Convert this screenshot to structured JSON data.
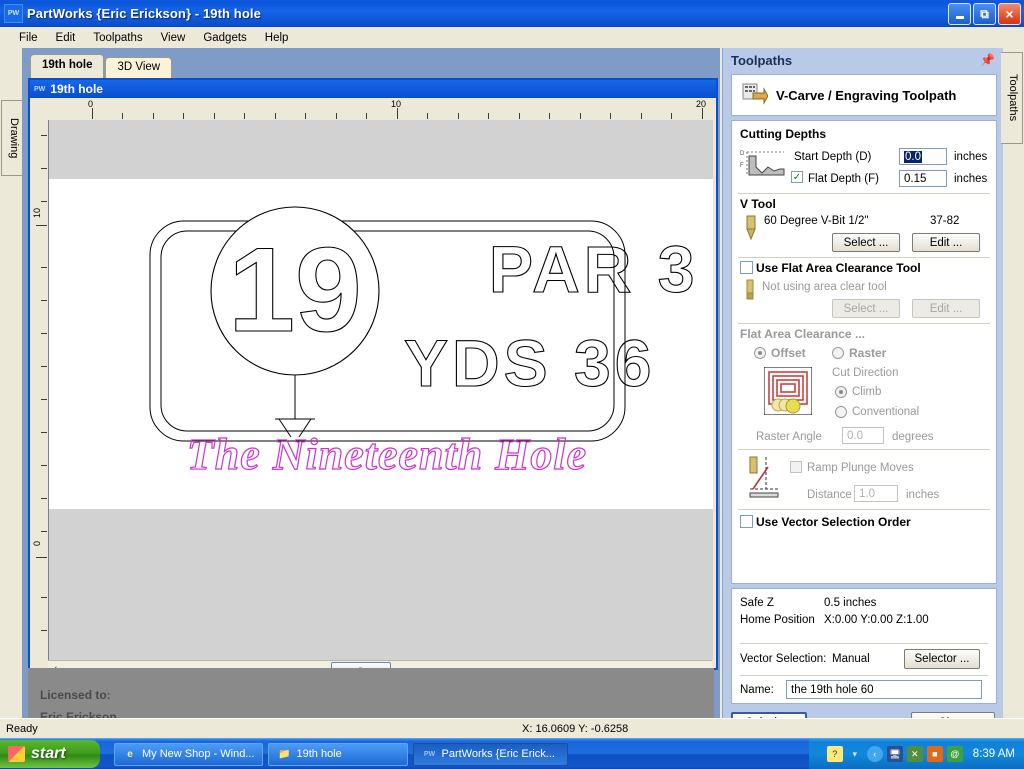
{
  "window": {
    "title": "PartWorks {Eric Erickson} - 19th hole",
    "app_icon": "PW",
    "minimize_label": "_",
    "restore_label": "❐",
    "close_label": "×"
  },
  "menubar": {
    "items": [
      "File",
      "Edit",
      "Toolpaths",
      "View",
      "Gadgets",
      "Help"
    ]
  },
  "left_dock": {
    "tab_label": "Drawing"
  },
  "right_dock": {
    "tab_label": "Toolpaths"
  },
  "document": {
    "tabs": [
      {
        "label": "19th hole",
        "active": true
      },
      {
        "label": "3D View",
        "active": false
      }
    ],
    "child_window_title": "19th hole",
    "child_window_icon": "PW",
    "h_ruler_labels": [
      "0",
      "10",
      "20"
    ],
    "v_ruler_labels": [
      "10",
      "0"
    ],
    "scroll_left_arrow": "‹",
    "scroll_thumb_grip": "‖"
  },
  "artwork": {
    "number_badge": "19",
    "line1": "PAR 3",
    "line2": "YDS 36",
    "script_text": "The Nineteenth Hole",
    "script_color": "#cc33cc",
    "outline_color": "#000000"
  },
  "license": {
    "line1": "Licensed to:",
    "line2": "Eric Erickson"
  },
  "toolpaths": {
    "panel_title": "Toolpaths",
    "pin_icon": "auto-hide-pin-icon",
    "type_label": "V-Carve / Engraving Toolpath",
    "cutting_depths": {
      "title": "Cutting Depths",
      "start_depth_label": "Start Depth (D)",
      "start_depth_value": "0.0",
      "start_depth_units": "inches",
      "flat_depth_label": "Flat Depth (F)",
      "flat_depth_checked": true,
      "flat_depth_value": "0.15",
      "flat_depth_units": "inches"
    },
    "v_tool": {
      "title": "V Tool",
      "tool_name": "60 Degree V-Bit 1/2\"",
      "tool_number": "37-82",
      "select_label": "Select ...",
      "edit_label": "Edit ..."
    },
    "area_clearance_tool": {
      "checkbox_label": "Use Flat Area Clearance Tool",
      "checked": false,
      "status_text": "Not using area clear tool",
      "select_label": "Select ...",
      "edit_label": "Edit ..."
    },
    "flat_area_clearance": {
      "title": "Flat Area Clearance ...",
      "offset_label": "Offset",
      "raster_label": "Raster",
      "strategy_selected": "Offset",
      "cut_direction_label": "Cut Direction",
      "climb_label": "Climb",
      "conventional_label": "Conventional",
      "cut_direction_selected": "Climb",
      "raster_angle_label": "Raster Angle",
      "raster_angle_value": "0.0",
      "raster_angle_units": "degrees"
    },
    "ramp": {
      "checkbox_label": "Ramp Plunge Moves",
      "checked": false,
      "distance_label": "Distance",
      "distance_value": "1.0",
      "distance_units": "inches"
    },
    "vector_selection_order": {
      "checkbox_label": "Use Vector Selection Order",
      "checked": false
    },
    "info": {
      "safe_z_label": "Safe Z",
      "safe_z_value": "0.5 inches",
      "home_label": "Home Position",
      "home_value": "X:0.00 Y:0.00 Z:1.00",
      "vector_selection_label": "Vector Selection:",
      "vector_selection_value": "Manual",
      "selector_button": "Selector ...",
      "name_label": "Name:",
      "name_value": "the 19th hole 60"
    },
    "calculate_label": "Calculate",
    "close_label": "Close"
  },
  "statusbar": {
    "message": "Ready",
    "coordinates": "X: 16.0609 Y: -0.6258"
  },
  "taskbar": {
    "start_label": "start",
    "buttons": [
      {
        "label": "My New Shop - Wind...",
        "icon": "internet-explorer-icon",
        "active": false
      },
      {
        "label": "19th hole",
        "icon": "folder-icon",
        "active": false
      },
      {
        "label": "PartWorks {Eric Erick...",
        "icon": "partworks-icon",
        "active": true
      }
    ],
    "tray_icons": [
      "help-icon",
      "network-icon",
      "shield-icon",
      "security-icon",
      "update-icon",
      "spiral-icon"
    ],
    "clock": "8:39 AM"
  }
}
